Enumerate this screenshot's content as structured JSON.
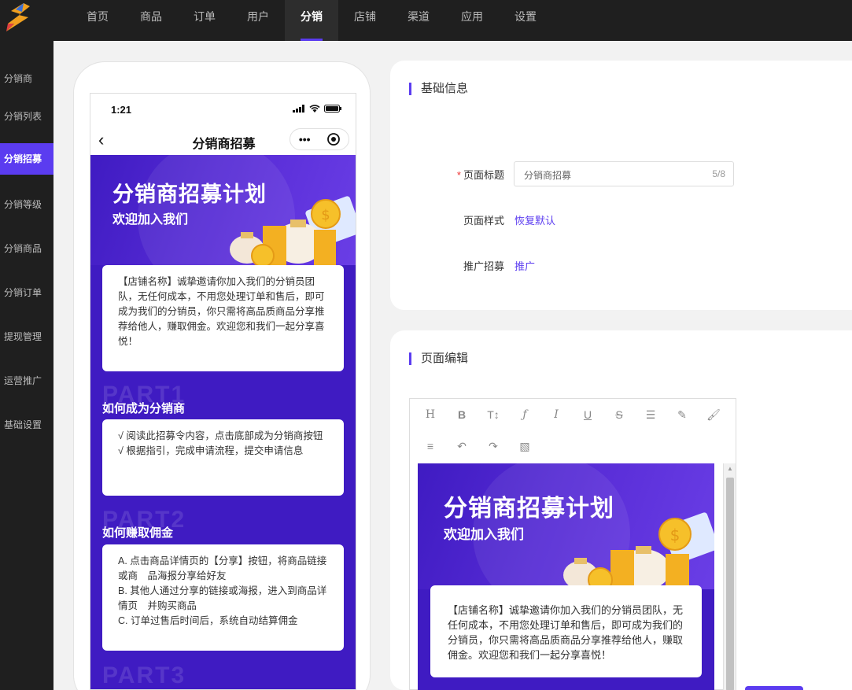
{
  "nav": {
    "items": [
      {
        "label": "首页",
        "active": false
      },
      {
        "label": "商品",
        "active": false
      },
      {
        "label": "订单",
        "active": false
      },
      {
        "label": "用户",
        "active": false
      },
      {
        "label": "分销",
        "active": true
      },
      {
        "label": "店铺",
        "active": false
      },
      {
        "label": "渠道",
        "active": false
      },
      {
        "label": "应用",
        "active": false
      },
      {
        "label": "设置",
        "active": false
      }
    ]
  },
  "sidebar": {
    "items": [
      {
        "label": "分销商",
        "active": false
      },
      {
        "label": "分销列表",
        "active": false
      },
      {
        "label": "分销招募",
        "active": true
      },
      {
        "label": "分销等级",
        "active": false
      },
      {
        "label": "分销商品",
        "active": false
      },
      {
        "label": "分销订单",
        "active": false
      },
      {
        "label": "提现管理",
        "active": false
      },
      {
        "label": "运营推广",
        "active": false
      },
      {
        "label": "基础设置",
        "active": false
      }
    ]
  },
  "phone": {
    "time": "1:21",
    "title": "分销商招募",
    "hero_title": "分销商招募计划",
    "hero_sub": "欢迎加入我们",
    "intro": "【店铺名称】诚挚邀请你加入我们的分销员团队，无任何成本，不用您处理订单和售后，即可成为我们的分销员，你只需将高品质商品分享推荐给他人，赚取佣金。欢迎您和我们一起分享喜悦！",
    "part1_bg": "PART1",
    "part1_title": "如何成为分销商",
    "part1_lines": [
      "√ 阅读此招募令内容，点击底部成为分销商按钮",
      "√ 根据指引，完成申请流程，提交申请信息"
    ],
    "part2_bg": "PART2",
    "part2_title": "如何赚取佣金",
    "part2_lines": [
      "A. 点击商品详情页的【分享】按钮，将商品链接或商　品海报分享给好友",
      "B. 其他人通过分享的链接或海报，进入到商品详情页　并购买商品",
      "C. 订单过售后时间后，系统自动结算佣金"
    ],
    "part3_bg": "PART3"
  },
  "basic": {
    "section_title": "基础信息",
    "title_label": "页面标题",
    "title_value": "分销商招募",
    "title_count": "5/8",
    "style_label": "页面样式",
    "style_link": "恢复默认",
    "promo_label": "推广招募",
    "promo_link": "推广"
  },
  "editor": {
    "section_title": "页面编辑",
    "hero_title": "分销商招募计划",
    "hero_sub": "欢迎加入我们",
    "intro": "【店铺名称】诚挚邀请你加入我们的分销员团队，无任何成本，不用您处理订单和售后，即可成为我们的分销员，你只需将高品质商品分享推荐给他人，赚取佣金。欢迎您和我们一起分享喜悦！",
    "tools": [
      "heading-icon",
      "bold-icon",
      "font-size-icon",
      "font-family-icon",
      "italic-icon",
      "underline-icon",
      "strikethrough-icon",
      "indent-icon",
      "highlight-icon",
      "brush-icon",
      "align-icon",
      "undo-icon",
      "redo-icon",
      "image-icon"
    ]
  },
  "colors": {
    "accent": "#5b3cf0",
    "dark": "#1f1f1f",
    "hero": "#3f1bc2"
  }
}
